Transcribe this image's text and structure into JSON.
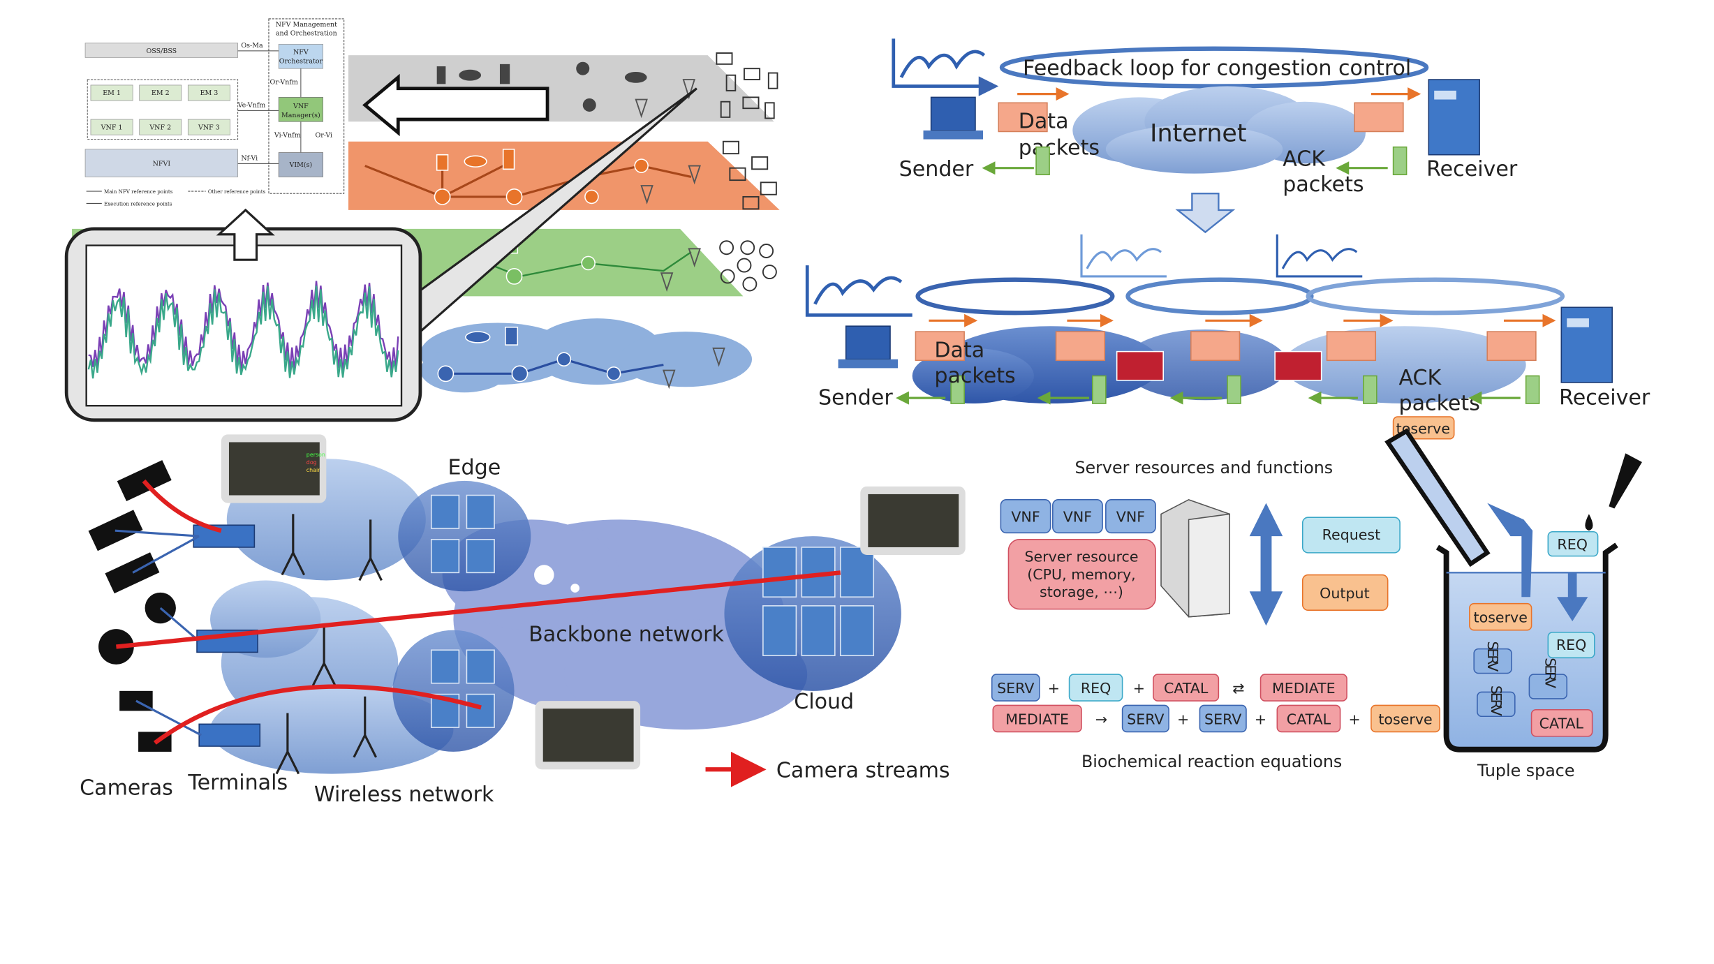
{
  "nfv_architecture": {
    "mano_title_1": "NFV Management",
    "mano_title_2": "and Orchestration",
    "oss_bss": "OSS/BSS",
    "os_ma": "Os-Ma",
    "orchestrator_1": "NFV",
    "orchestrator_2": "Orchestrator",
    "or_vnfm": "Or-Vnfm",
    "ve_vnfm": "Ve-Vnfm",
    "vnf_manager_1": "VNF",
    "vnf_manager_2": "Manager(s)",
    "vi_vnfm": "Vi-Vnfm",
    "or_vi": "Or-Vi",
    "nf_vi": "Nf-Vi",
    "nfvi": "NFVI",
    "vim": "VIM(s)",
    "em": [
      "EM 1",
      "EM 2",
      "EM 3"
    ],
    "vnf": [
      "VNF 1",
      "VNF 2",
      "VNF 3"
    ],
    "legend_main": "Main NFV reference points",
    "legend_other": "Other reference points",
    "legend_exec": "Execution reference points"
  },
  "congestion": {
    "feedback_loop": "Feedback loop for congestion control",
    "internet": "Internet",
    "sender": "Sender",
    "receiver": "Receiver",
    "data_packets_1": "Data",
    "data_packets_2": "packets",
    "ack_packets_1": "ACK",
    "ack_packets_2": "packets",
    "toserve": "toserve"
  },
  "camera_network": {
    "edge": "Edge",
    "backbone": "Backbone network",
    "cloud": "Cloud",
    "cameras": "Cameras",
    "terminals": "Terminals",
    "wireless": "Wireless network",
    "legend_streams": "Camera streams",
    "detections": [
      "person",
      "dog",
      "chair"
    ],
    "stream_color": "#e02020"
  },
  "chemical": {
    "server_title": "Server resources and functions",
    "vnf": [
      "VNF",
      "VNF",
      "VNF"
    ],
    "server_resource_1": "Server resource",
    "server_resource_2": "(CPU, memory,",
    "server_resource_3": "storage, ⋯)",
    "request": "Request",
    "output": "Output",
    "eq1": [
      "SERV",
      "+",
      "REQ",
      "+",
      "CATAL",
      "⇄",
      "MEDIATE"
    ],
    "eq2": [
      "MEDIATE",
      "→",
      "SERV",
      "+",
      "SERV",
      "+",
      "CATAL",
      "+",
      "toserve"
    ],
    "equations_title": "Biochemical reaction equations",
    "tuple_space": "Tuple space",
    "beaker_req_top": "REQ",
    "beaker_toserve": "toserve",
    "beaker_req": "REQ",
    "beaker_catal": "CATAL",
    "beaker_serv": "SERV"
  },
  "colors": {
    "serv_blue": "#8fb3e3",
    "req_cyan": "#bfe6f2",
    "catal_red": "#f2a0a4",
    "toserve_orange": "#f9c18f",
    "layer_orange": "#f0956a",
    "layer_green": "#9ccf86",
    "cloud_blue": "#8fb0dd"
  }
}
